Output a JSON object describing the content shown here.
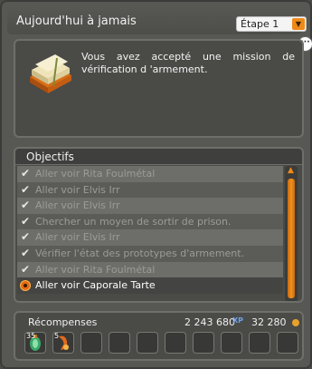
{
  "header": {
    "title": "Aujourd'hui à jamais",
    "step_selected": "Étape 1"
  },
  "description": {
    "text": "Vous avez accepté une mission de vérification d 'armement."
  },
  "objectives": {
    "title": "Objectifs",
    "items": [
      {
        "label": "Aller voir Rita Foulmétal",
        "done": true
      },
      {
        "label": "Aller voir Elvis Irr",
        "done": true
      },
      {
        "label": "Aller voir Elvis Irr",
        "done": true
      },
      {
        "label": "Chercher un moyen de sortir de prison.",
        "done": true
      },
      {
        "label": "Aller voir Elvis Irr",
        "done": true
      },
      {
        "label": "Vérifier l'état des prototypes d'armement.",
        "done": true
      },
      {
        "label": "Aller voir Rita Foulmétal",
        "done": true
      },
      {
        "label": "Aller voir Caporale Tarte",
        "done": false
      }
    ]
  },
  "rewards": {
    "title": "Récompenses",
    "xp": "2 243 680",
    "kamas": "32 280",
    "slots": [
      {
        "quantity": "35",
        "icon": "potion-icon"
      },
      {
        "quantity": "5",
        "icon": "scroll-icon"
      },
      {
        "quantity": ""
      },
      {
        "quantity": ""
      },
      {
        "quantity": ""
      },
      {
        "quantity": ""
      },
      {
        "quantity": ""
      },
      {
        "quantity": ""
      },
      {
        "quantity": ""
      },
      {
        "quantity": ""
      }
    ]
  }
}
